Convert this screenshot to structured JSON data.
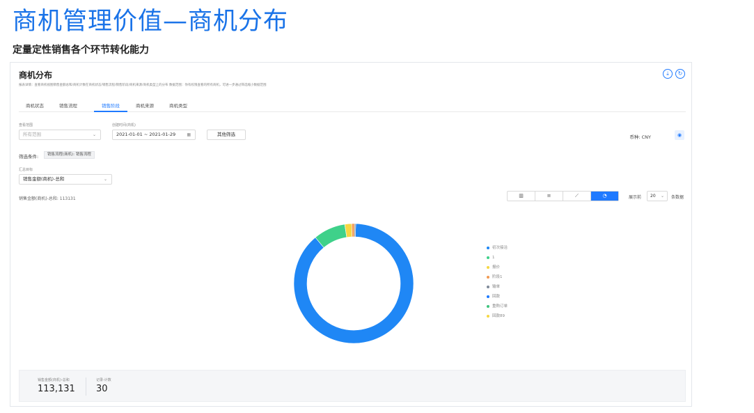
{
  "page": {
    "title": "商机管理价值—商机分布",
    "subtitle": "定量定性销售各个环节转化能力"
  },
  "panel": {
    "title": "商机分布",
    "description": "报表详情：查看商机视图销售金额总和/商机计数在商机状态/销售流程/销售阶段/商机来源/商机类型上的分布 数据范围：你有权限查看的所有商机，可进一步通过筛选缩小数据范围",
    "download_icon": "download-icon",
    "refresh_icon": "refresh-icon"
  },
  "tabs": [
    {
      "label": "商机状态",
      "active": false
    },
    {
      "label": "销售流程",
      "active": false
    },
    {
      "label": "销售阶段",
      "active": true
    },
    {
      "label": "商机来源",
      "active": false
    },
    {
      "label": "商机类型",
      "active": false
    }
  ],
  "filters": {
    "scope_label": "查看范围",
    "scope_value": "所有范围",
    "date_label": "创建时间(商机)",
    "date_value": "2021-01-01 ~ 2021-01-29",
    "other_filter_button": "其他筛选",
    "currency": "币种: CNY",
    "condition_label": "筛选条件:",
    "condition_tag": "销售流程(商机): 销售流程",
    "summary_target_label": "汇总目标",
    "summary_target_value": "销售金额(商机)-总和"
  },
  "chart_header": {
    "metric_text": "销售金额(商机)-总和: 113131",
    "chart_types": [
      "bar-chart-icon",
      "horizontal-bar-icon",
      "line-chart-icon",
      "pie-chart-icon"
    ],
    "active_chart_type": "pie-chart-icon",
    "show_prefix": "展示前",
    "show_count": "20",
    "show_suffix": "条数据"
  },
  "chart_data": {
    "type": "pie",
    "donut": true,
    "labels": [
      "初次接洽",
      "1",
      "报价",
      "阶段1",
      "输单",
      "回款",
      "重购订单",
      "回款89"
    ],
    "values": [
      100000,
      9800,
      2100,
      850,
      381,
      0,
      0,
      0
    ],
    "colors": [
      "#1f87f5",
      "#3fd18a",
      "#f6d743",
      "#f29a52",
      "#7f8a99",
      "#1f7aff",
      "#3fc47e",
      "#f6d743"
    ],
    "legend_position": "right"
  },
  "summary": {
    "amount_label": "销售金额(商机)-总和",
    "amount_value": "113,131",
    "count_label": "记录-计数",
    "count_value": "30"
  }
}
